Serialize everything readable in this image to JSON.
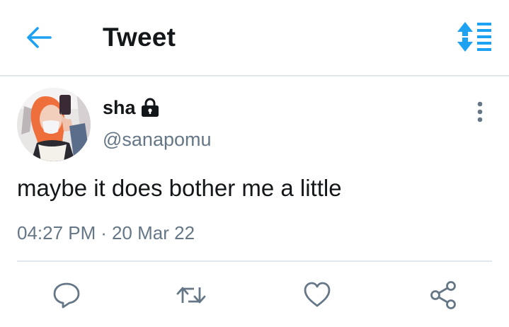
{
  "header": {
    "title": "Tweet",
    "back_icon": "arrow-left-icon",
    "sort_icon": "sort-icon"
  },
  "tweet": {
    "user": {
      "name": "sha",
      "handle": "@sanapomu",
      "protected": true
    },
    "text": "maybe it does bother me a little",
    "time": "04:27 PM",
    "separator": "·",
    "date": "20 Mar 22"
  },
  "actions": [
    {
      "name": "reply",
      "icon": "reply-icon"
    },
    {
      "name": "retweet",
      "icon": "retweet-icon"
    },
    {
      "name": "like",
      "icon": "heart-icon"
    },
    {
      "name": "share",
      "icon": "share-icon"
    }
  ],
  "colors": {
    "accent": "#1da1f2",
    "text": "#14171a",
    "secondary": "#657786",
    "divider": "#e1e8ed"
  }
}
